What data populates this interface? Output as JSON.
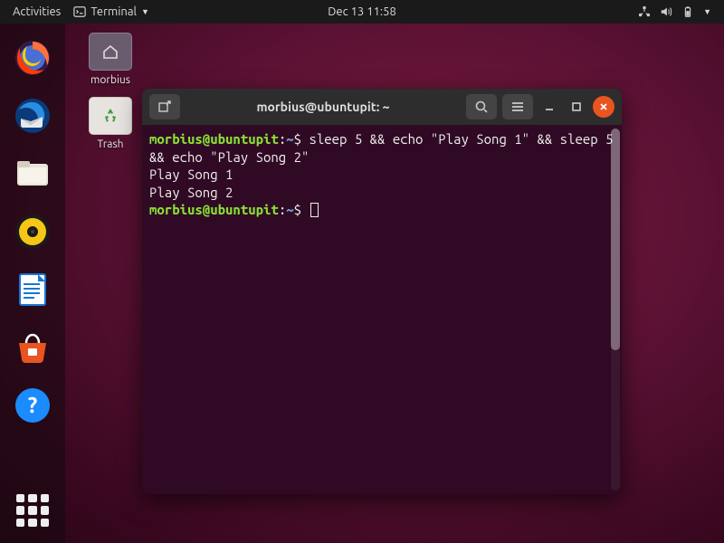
{
  "topbar": {
    "activities": "Activities",
    "app_label": "Terminal",
    "datetime": "Dec 13  11:58"
  },
  "desktop": {
    "home_label": "morbius",
    "trash_label": "Trash"
  },
  "dock": {
    "apps": [
      "firefox",
      "thunderbird",
      "files",
      "rhythmbox",
      "libreoffice-writer",
      "ubuntu-software",
      "help"
    ]
  },
  "terminal": {
    "title": "morbius@ubuntupit: ~",
    "prompt": {
      "user_host": "morbius@ubuntupit",
      "sep1": ":",
      "path": "~",
      "sep2": "$ "
    },
    "command": "sleep 5 && echo \"Play Song 1\" && sleep 5 && echo \"Play Song 2\"",
    "output": [
      "Play Song 1",
      "Play Song 2"
    ]
  }
}
